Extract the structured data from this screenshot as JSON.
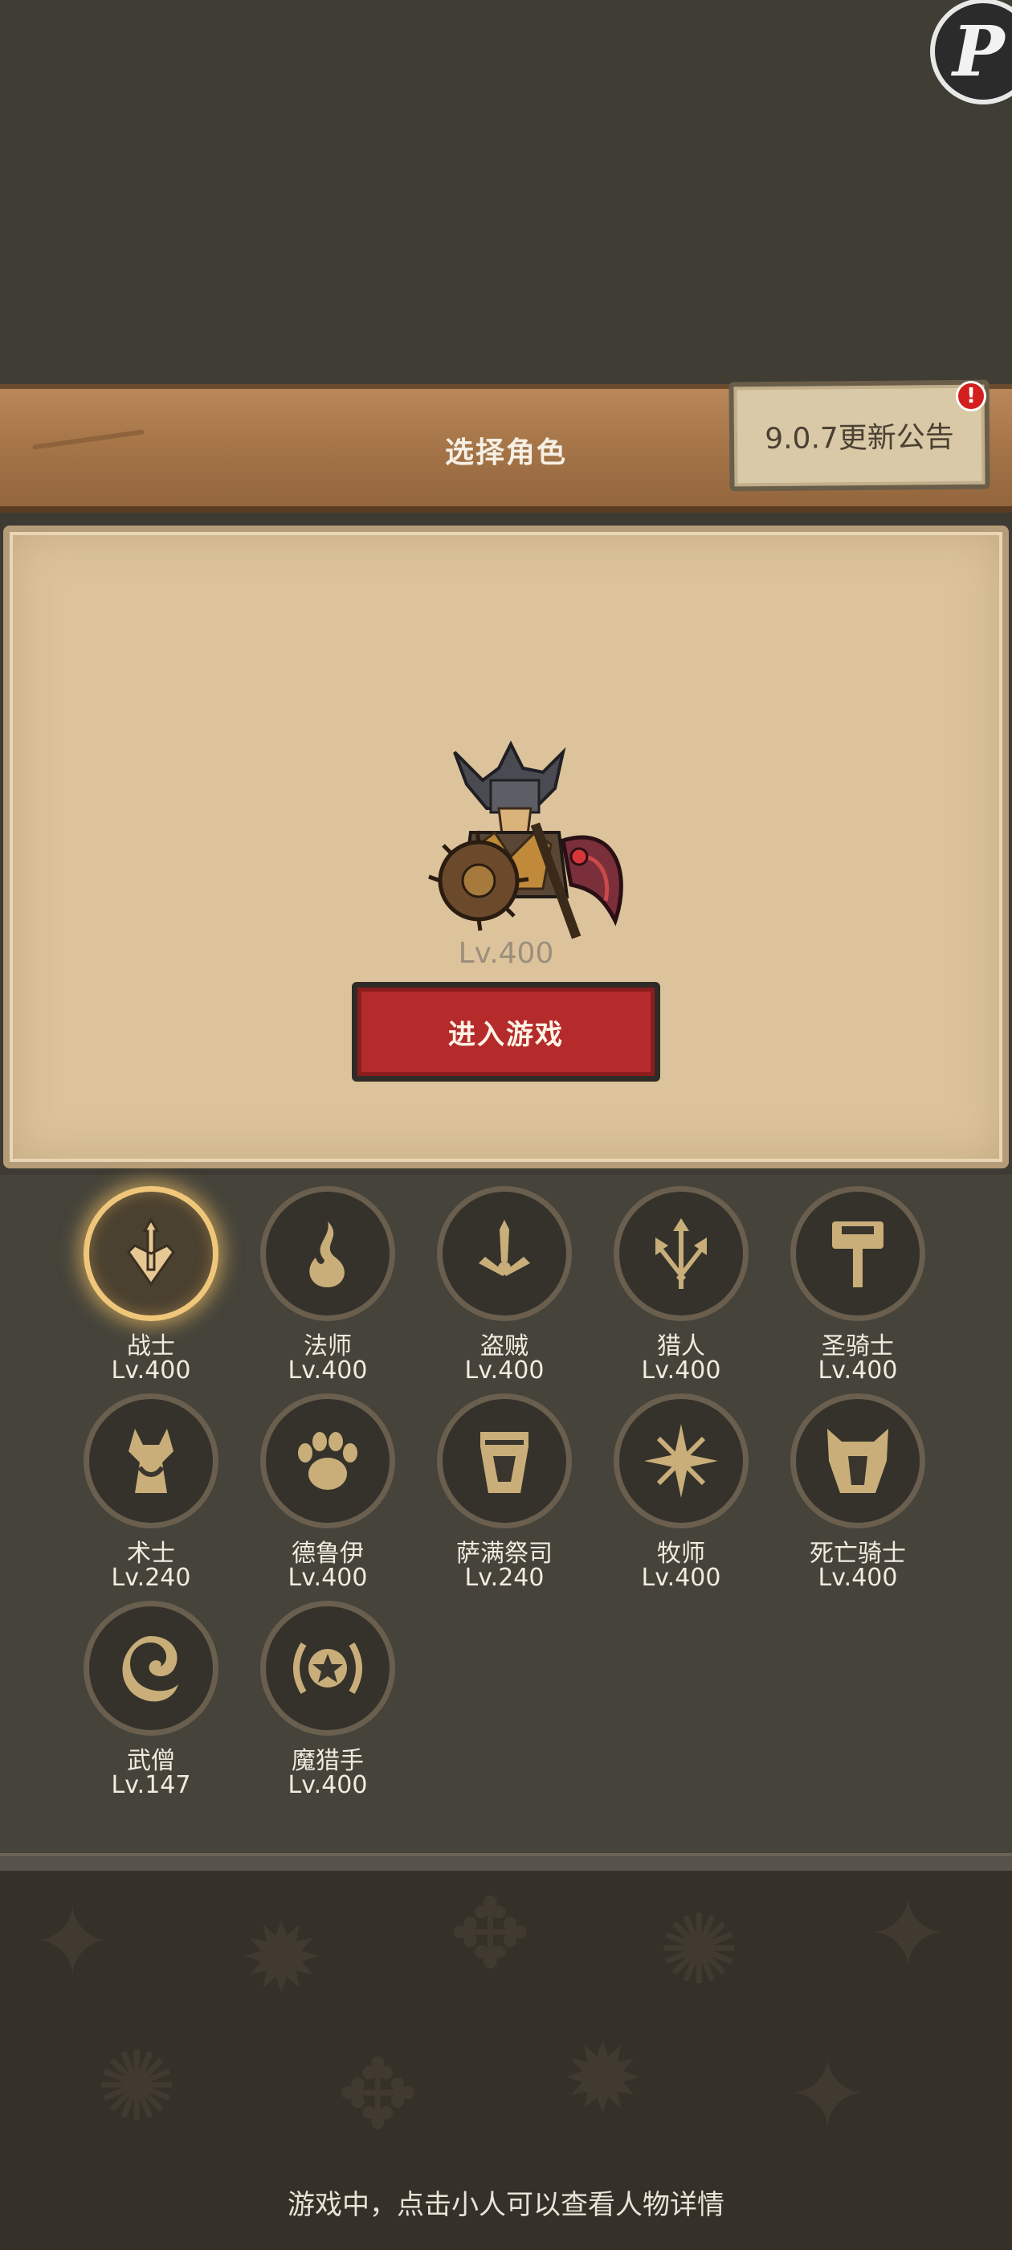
{
  "header": {
    "title": "选择角色"
  },
  "notice": {
    "label": "9.0.7更新公告",
    "badge": "!"
  },
  "character": {
    "level": "Lv.400"
  },
  "enter_button": {
    "label": "进入游戏"
  },
  "classes": [
    {
      "name": "战士",
      "level": "Lv.400",
      "icon": "sword-icon",
      "selected": true
    },
    {
      "name": "法师",
      "level": "Lv.400",
      "icon": "flame-icon"
    },
    {
      "name": "盗贼",
      "level": "Lv.400",
      "icon": "daggers-icon"
    },
    {
      "name": "猎人",
      "level": "Lv.400",
      "icon": "arrows-icon"
    },
    {
      "name": "圣骑士",
      "level": "Lv.400",
      "icon": "hammer-icon"
    },
    {
      "name": "术士",
      "level": "Lv.240",
      "icon": "demon-skull-icon"
    },
    {
      "name": "德鲁伊",
      "level": "Lv.400",
      "icon": "paw-icon"
    },
    {
      "name": "萨满祭司",
      "level": "Lv.240",
      "icon": "totem-icon"
    },
    {
      "name": "牧师",
      "level": "Lv.400",
      "icon": "holy-star-icon"
    },
    {
      "name": "死亡骑士",
      "level": "Lv.400",
      "icon": "helmet-icon"
    },
    {
      "name": "武僧",
      "level": "Lv.147",
      "icon": "swirl-icon"
    },
    {
      "name": "魔猎手",
      "level": "Lv.400",
      "icon": "star-emblem-icon"
    }
  ],
  "footer": {
    "hint": "游戏中，点击小人可以查看人物详情"
  }
}
